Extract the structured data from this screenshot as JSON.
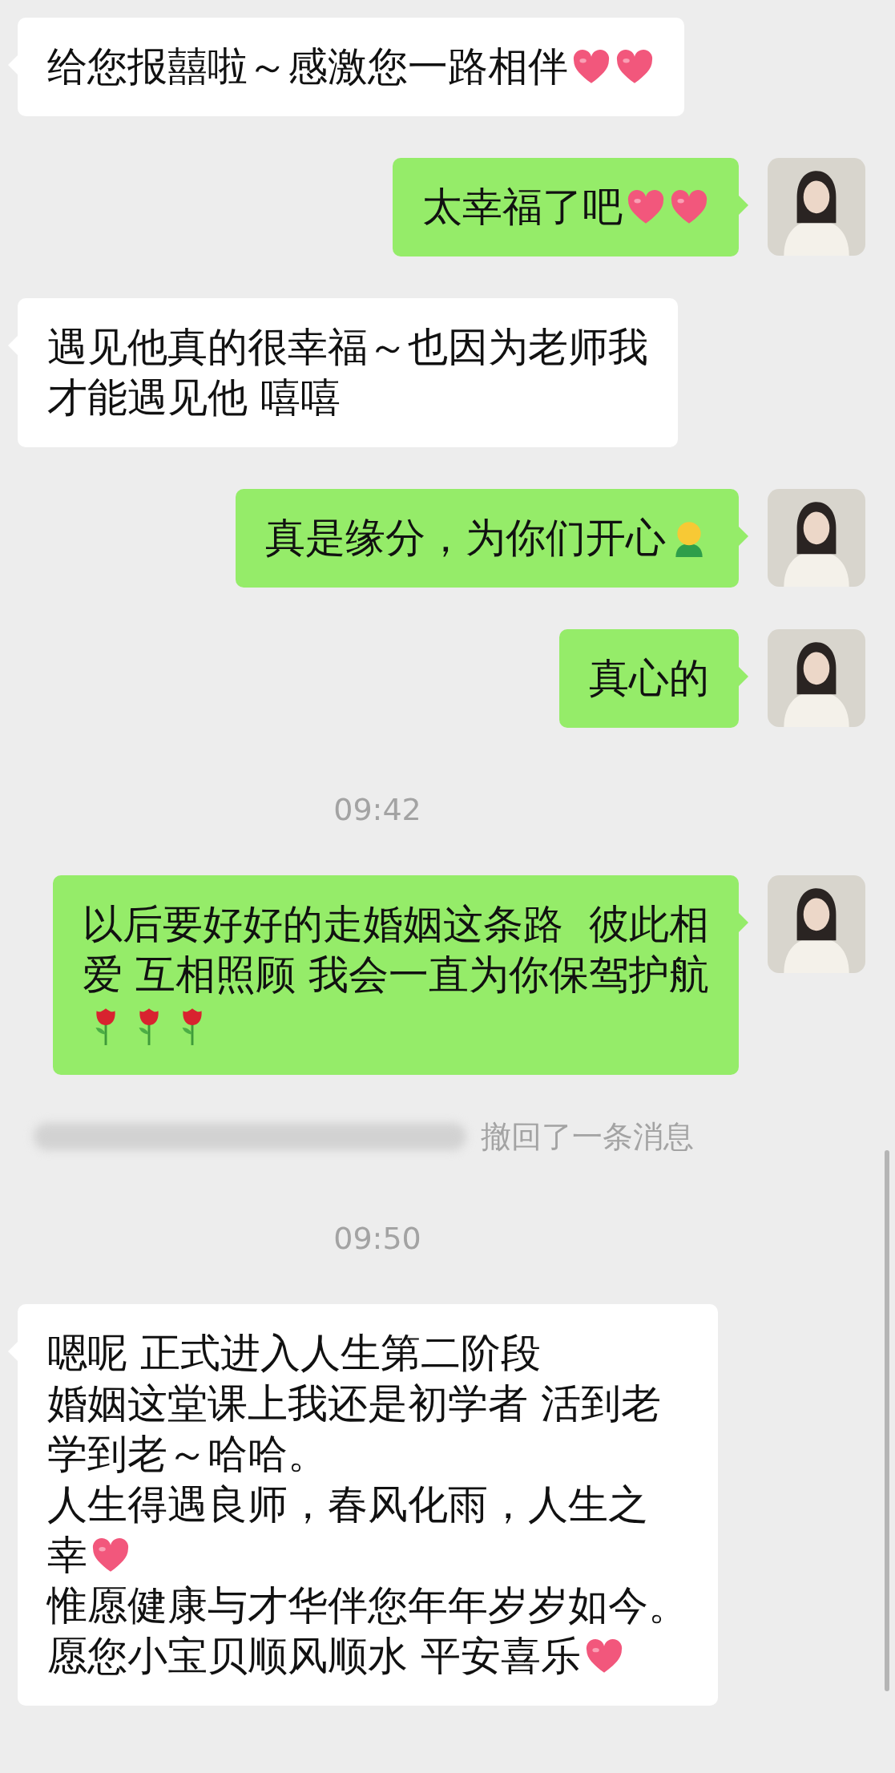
{
  "messages": [
    {
      "kind": "incoming",
      "lines": [
        {
          "text": "给您报囍啦～感激您一路相伴",
          "emoji": [
            {
              "kind": "heart"
            },
            {
              "kind": "heart"
            }
          ]
        }
      ]
    },
    {
      "kind": "outgoing",
      "lines": [
        {
          "text": "太幸福了吧",
          "emoji": [
            {
              "kind": "heart"
            },
            {
              "kind": "heart"
            }
          ]
        }
      ]
    },
    {
      "kind": "incoming",
      "lines": [
        {
          "text": "遇见他真的很幸福～也因为老师我"
        },
        {
          "text": "才能遇见他 嘻嘻"
        }
      ]
    },
    {
      "kind": "outgoing",
      "lines": [
        {
          "text": "真是缘分，为你们开心",
          "emoji": [
            {
              "kind": "figure"
            }
          ]
        }
      ]
    },
    {
      "kind": "outgoing",
      "lines": [
        {
          "text": "真心的"
        }
      ]
    },
    {
      "kind": "time",
      "text": "09:42"
    },
    {
      "kind": "outgoing",
      "lines": [
        {
          "text": "以后要好好的走婚姻这条路  彼此相"
        },
        {
          "text": "爱 互相照顾 我会一直为你保驾护航"
        },
        {
          "emoji": [
            {
              "kind": "rose"
            },
            {
              "kind": "rose"
            },
            {
              "kind": "rose"
            }
          ]
        }
      ]
    },
    {
      "kind": "recall",
      "text": "撤回了一条消息"
    },
    {
      "kind": "time",
      "text": "09:50"
    },
    {
      "kind": "incoming",
      "lines": [
        {
          "text": "嗯呢 正式进入人生第二阶段"
        },
        {
          "text": "婚姻这堂课上我还是初学者 活到老"
        },
        {
          "text": "学到老～哈哈。"
        },
        {
          "text": "人生得遇良师，春风化雨，人生之"
        },
        {
          "text": "幸",
          "emoji": [
            {
              "kind": "heart"
            }
          ]
        },
        {
          "text": "惟愿健康与才华伴您年年岁岁如今。"
        },
        {
          "text": "愿您小宝贝顺风顺水 平安喜乐",
          "emoji": [
            {
              "kind": "heart"
            }
          ]
        }
      ]
    }
  ]
}
